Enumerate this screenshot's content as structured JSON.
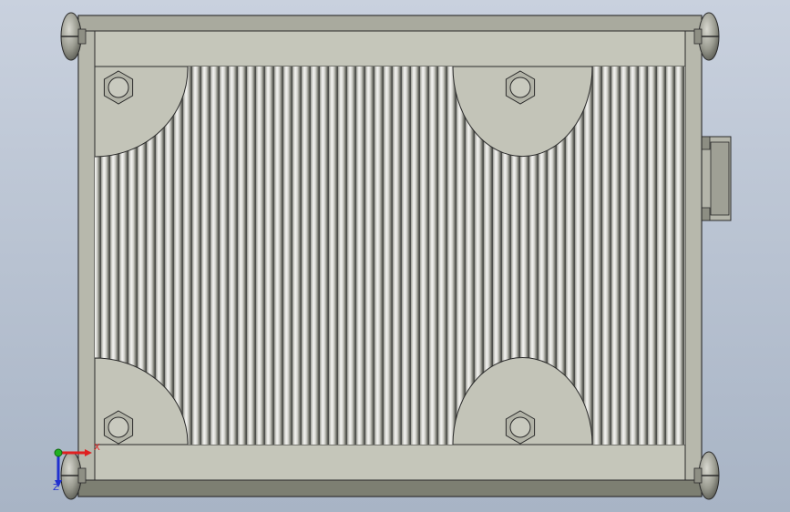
{
  "viewport": {
    "background_top": "#c9d1de",
    "background_bottom": "#a8b4c5"
  },
  "model": {
    "name": "heatsink-enclosure",
    "body_color": "#bfbfb4",
    "edge_color": "#2a2a2a",
    "dark_band_color": "#7d7f72",
    "fin_light": "#f4f4f2",
    "fin_dark": "#5f6059",
    "fin_count_left": 4,
    "fin_count_main": 28,
    "fin_count_right": 10,
    "bolts": 4,
    "corner_screws": 4,
    "side_connector": true
  },
  "triad": {
    "x_label": "X",
    "z_label": "Z",
    "x_color": "#e02020",
    "y_color": "#20b020",
    "z_color": "#2030d0"
  }
}
